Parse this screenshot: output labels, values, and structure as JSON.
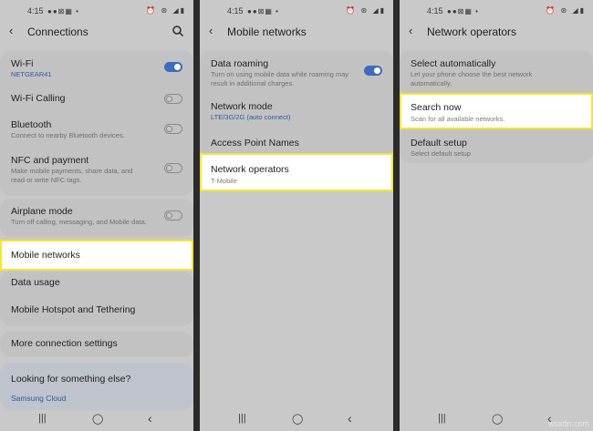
{
  "status_bar": {
    "time": "4:15",
    "left_icons": "●●⊠▦ •",
    "right_icons": "⏰ ⊛ ◢▮"
  },
  "panel1": {
    "title": "Connections",
    "items": [
      {
        "label": "Wi-Fi",
        "sub": "NETGEAR41",
        "toggle": "on"
      },
      {
        "label": "Wi-Fi Calling",
        "sub": "",
        "toggle": "off"
      },
      {
        "label": "Bluetooth",
        "sub": "Connect to nearby Bluetooth devices.",
        "toggle": "off"
      },
      {
        "label": "NFC and payment",
        "sub": "Make mobile payments, share data, and read or write NFC tags.",
        "toggle": "off"
      },
      {
        "label": "Airplane mode",
        "sub": "Turn off calling, messaging, and Mobile data.",
        "toggle": "off"
      },
      {
        "label": "Mobile networks",
        "sub": "",
        "highlighted": true
      },
      {
        "label": "Data usage",
        "sub": ""
      },
      {
        "label": "Mobile Hotspot and Tethering",
        "sub": ""
      },
      {
        "label": "More connection settings",
        "sub": ""
      }
    ],
    "footer": {
      "title": "Looking for something else?",
      "link": "Samsung Cloud"
    }
  },
  "panel2": {
    "title": "Mobile networks",
    "items": [
      {
        "label": "Data roaming",
        "sub": "Turn on using mobile data while roaming may result in additional charges.",
        "toggle": "on"
      },
      {
        "label": "Network mode",
        "sub": "LTE/3G/2G (auto connect)"
      },
      {
        "label": "Access Point Names",
        "sub": ""
      },
      {
        "label": "Network operators",
        "sub": "T-Mobile",
        "highlighted": true
      }
    ]
  },
  "panel3": {
    "title": "Network operators",
    "items": [
      {
        "label": "Select automatically",
        "sub": "Let your phone choose the best network automatically."
      },
      {
        "label": "Search now",
        "sub": "Scan for all available networks.",
        "highlighted": true
      },
      {
        "label": "Default setup",
        "sub": "Select default setup"
      }
    ]
  },
  "nav": {
    "recents": "|||",
    "home": "◯",
    "back": "‹"
  },
  "watermark": "wsxdn.com",
  "colors": {
    "panel_bg": "#c9c9c9",
    "card_bg": "#c2c2c2",
    "highlight_border": "#f4e631",
    "toggle_on": "#3b6bc2"
  }
}
